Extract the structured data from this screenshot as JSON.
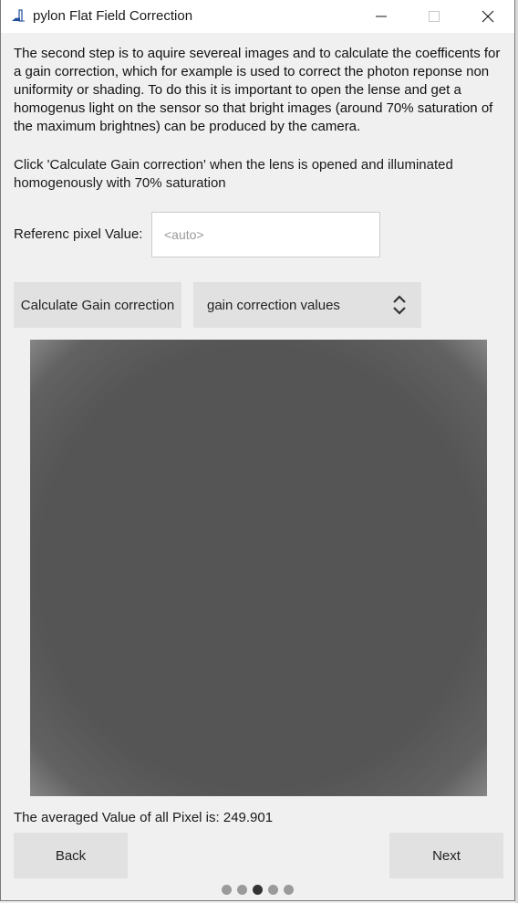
{
  "window": {
    "title": "pylon Flat Field Correction",
    "controls": {
      "minimize": "minimize-icon",
      "maximize": "maximize-icon",
      "close": "close-icon"
    }
  },
  "instructions": {
    "paragraph1": "The second step is to aquire severeal images and to calculate the coefficents for a gain correction, which for example is used to correct the photon reponse non uniformity or shading. To do this it is important to open the lense and get a homogenus light on the sensor so that bright images (around 70% saturation of the maximum brightnes) can be produced by the camera.",
    "paragraph2": "Click 'Calculate Gain correction' when the lens is opened and illuminated homogenously with 70% saturation"
  },
  "reference": {
    "label": "Referenc pixel Value:",
    "value": "",
    "placeholder": "<auto>"
  },
  "actions": {
    "calculate_label": "Calculate Gain correction",
    "view_select": {
      "selected": "gain correction values",
      "icon": "up-down-chevron-icon"
    }
  },
  "result": {
    "averaged_text": "The averaged Value of all Pixel is: 249.901"
  },
  "navigation": {
    "back_label": "Back",
    "next_label": "Next",
    "steps_total": 5,
    "current_step": 3
  }
}
